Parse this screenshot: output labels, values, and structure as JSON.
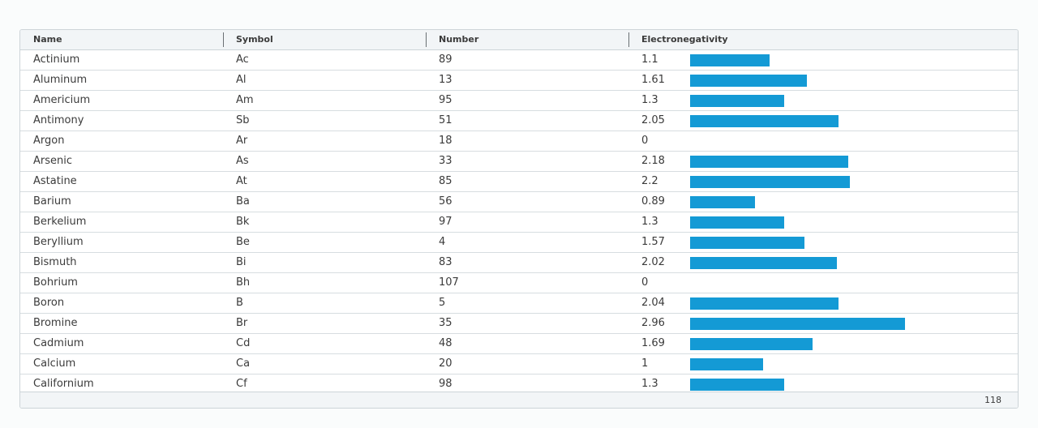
{
  "columns": {
    "name": "Name",
    "symbol": "Symbol",
    "number": "Number",
    "electronegativity": "Electronegativity"
  },
  "bar_color": "#149ad5",
  "rows": [
    {
      "name": "Actinium",
      "symbol": "Ac",
      "number": "89",
      "electronegativity": "1.1"
    },
    {
      "name": "Aluminum",
      "symbol": "Al",
      "number": "13",
      "electronegativity": "1.61"
    },
    {
      "name": "Americium",
      "symbol": "Am",
      "number": "95",
      "electronegativity": "1.3"
    },
    {
      "name": "Antimony",
      "symbol": "Sb",
      "number": "51",
      "electronegativity": "2.05"
    },
    {
      "name": "Argon",
      "symbol": "Ar",
      "number": "18",
      "electronegativity": "0"
    },
    {
      "name": "Arsenic",
      "symbol": "As",
      "number": "33",
      "electronegativity": "2.18"
    },
    {
      "name": "Astatine",
      "symbol": "At",
      "number": "85",
      "electronegativity": "2.2"
    },
    {
      "name": "Barium",
      "symbol": "Ba",
      "number": "56",
      "electronegativity": "0.89"
    },
    {
      "name": "Berkelium",
      "symbol": "Bk",
      "number": "97",
      "electronegativity": "1.3"
    },
    {
      "name": "Beryllium",
      "symbol": "Be",
      "number": "4",
      "electronegativity": "1.57"
    },
    {
      "name": "Bismuth",
      "symbol": "Bi",
      "number": "83",
      "electronegativity": "2.02"
    },
    {
      "name": "Bohrium",
      "symbol": "Bh",
      "number": "107",
      "electronegativity": "0"
    },
    {
      "name": "Boron",
      "symbol": "B",
      "number": "5",
      "electronegativity": "2.04"
    },
    {
      "name": "Bromine",
      "symbol": "Br",
      "number": "35",
      "electronegativity": "2.96"
    },
    {
      "name": "Cadmium",
      "symbol": "Cd",
      "number": "48",
      "electronegativity": "1.69"
    },
    {
      "name": "Calcium",
      "symbol": "Ca",
      "number": "20",
      "electronegativity": "1"
    },
    {
      "name": "Californium",
      "symbol": "Cf",
      "number": "98",
      "electronegativity": "1.3"
    }
  ],
  "footer": {
    "row_count": "118"
  }
}
